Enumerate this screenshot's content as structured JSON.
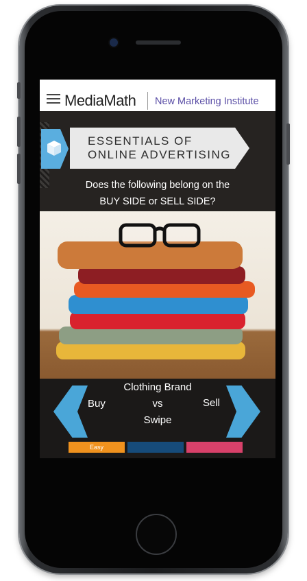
{
  "header": {
    "logo": "MediaMath",
    "subtitle": "New Marketing Institute"
  },
  "banner": {
    "title_line1": "ESSENTIALS OF",
    "title_line2": "ONLINE ADVERTISING"
  },
  "question": {
    "line1": "Does the following belong on the",
    "line2": "BUY SIDE or SELL SIDE?"
  },
  "card": {
    "item": "Clothing Brand",
    "vs": "vs",
    "action": "Swipe",
    "left_label": "Buy",
    "right_label": "Sell"
  },
  "difficulty": {
    "levels": [
      {
        "label": "Easy",
        "color": "#f0921e"
      },
      {
        "label": "",
        "color": "#164b7a"
      },
      {
        "label": "",
        "color": "#d8416a"
      }
    ]
  },
  "colors": {
    "accent_blue": "#4aa6d8",
    "brand_purple": "#5a4ea6",
    "background": "#262321"
  },
  "icons": [
    "menu-icon",
    "cube-icon",
    "chevron-left-icon",
    "chevron-right-icon"
  ]
}
